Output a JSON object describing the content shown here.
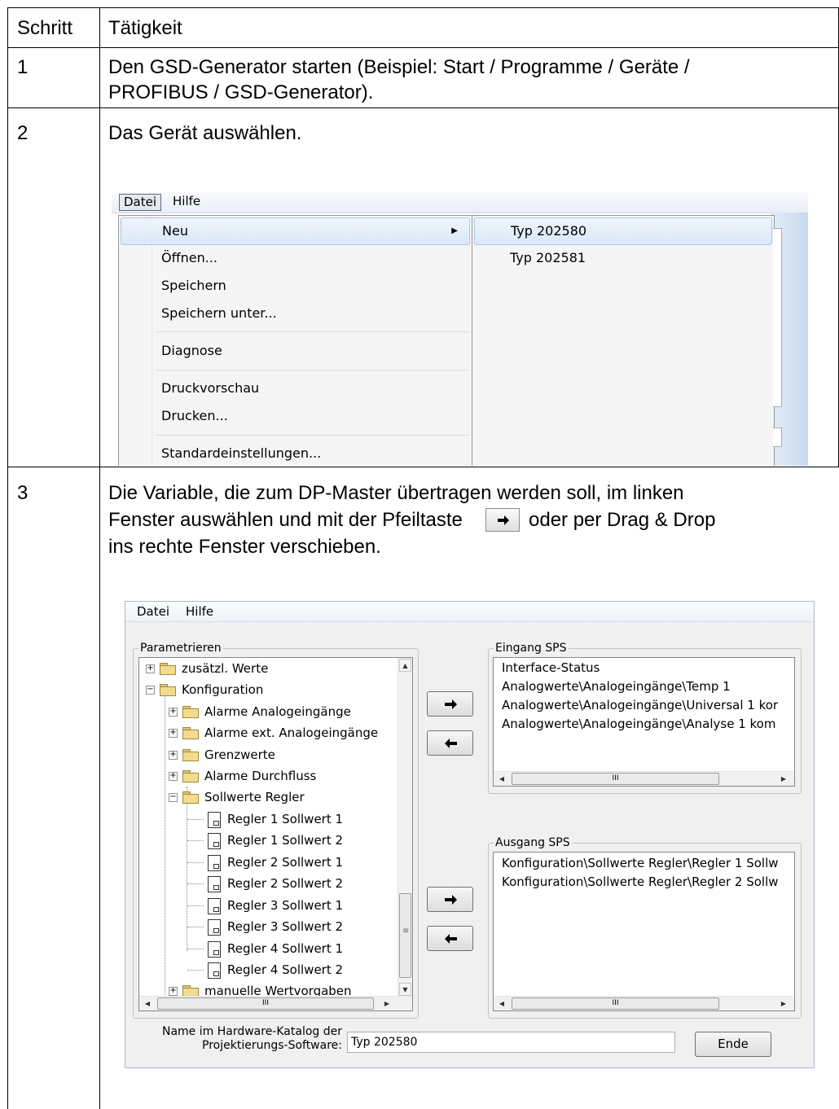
{
  "table": {
    "header": {
      "step": "Schritt",
      "activity": "Tätigkeit"
    },
    "rows": [
      {
        "step": "1",
        "lines": [
          "Den GSD-Generator starten (Beispiel: Start / Programme / Geräte /",
          "PROFIBUS / GSD-Generator)."
        ]
      },
      {
        "step": "2",
        "lines": [
          "Das Gerät auswählen."
        ]
      },
      {
        "step": "3",
        "lines": [
          "Die Variable, die zum DP-Master übertragen werden soll, im linken",
          "Fenster auswählen und mit der Pfeiltaste",
          "oder per Drag & Drop",
          "ins rechte Fenster verschieben."
        ]
      }
    ]
  },
  "shot1": {
    "menubar": [
      "Datei",
      "Hilfe"
    ],
    "menu_items": [
      "Neu",
      "Öffnen...",
      "Speichern",
      "Speichern unter...",
      "Diagnose",
      "Druckvorschau",
      "Drucken...",
      "Standardeinstellungen..."
    ],
    "submenu_items": [
      "Typ 202580",
      "Typ 202581"
    ]
  },
  "shot2": {
    "menubar": [
      "Datei",
      "Hilfe"
    ],
    "left_group_title": "Parametrieren",
    "tree": [
      "zusätzl. Werte",
      "Konfiguration",
      "Alarme Analogeingänge",
      "Alarme ext. Analogeingänge",
      "Grenzwerte",
      "Alarme Durchfluss",
      "Sollwerte Regler",
      "Regler 1 Sollwert 1",
      "Regler 1 Sollwert 2",
      "Regler 2 Sollwert 1",
      "Regler 2 Sollwert 2",
      "Regler 3 Sollwert 1",
      "Regler 3 Sollwert 2",
      "Regler 4 Sollwert 1",
      "Regler 4 Sollwert 2",
      "manuelle Wertvorgaben"
    ],
    "input_group_title": "Eingang SPS",
    "input_items": [
      "Interface-Status",
      "Analogwerte\\Analogeingänge\\Temp 1",
      "Analogwerte\\Analogeingänge\\Universal 1 kor",
      "Analogwerte\\Analogeingänge\\Analyse 1 kom"
    ],
    "output_group_title": "Ausgang SPS",
    "output_items": [
      "Konfiguration\\Sollwerte Regler\\Regler 1 Sollw",
      "Konfiguration\\Sollwerte Regler\\Regler 2 Sollw"
    ],
    "scroll_grip": "III",
    "scroll_grip_v": "≡",
    "catalog_label_1": "Name im Hardware-Katalog der",
    "catalog_label_2": "Projektierungs-Software:",
    "catalog_value": "Typ 202580",
    "end_button": "Ende"
  }
}
